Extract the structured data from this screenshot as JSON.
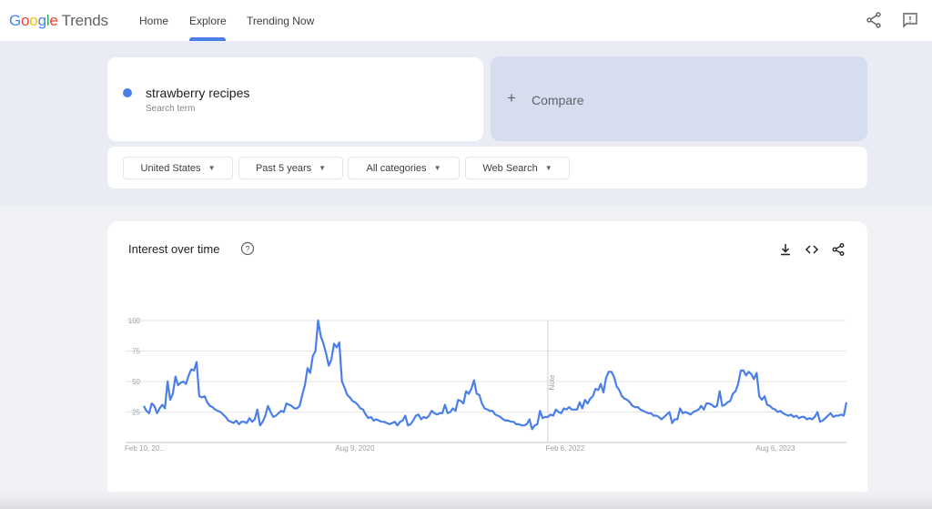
{
  "header": {
    "logo_letters": [
      "G",
      "o",
      "o",
      "g",
      "l",
      "e"
    ],
    "logo_product": "Trends",
    "nav": [
      {
        "label": "Home",
        "active": false
      },
      {
        "label": "Explore",
        "active": true
      },
      {
        "label": "Trending Now",
        "active": false
      }
    ],
    "icons": [
      "share-icon",
      "feedback-icon"
    ]
  },
  "search": {
    "term": "strawberry recipes",
    "term_type": "Search term",
    "term_color": "#4a7fe8",
    "compare_label": "Compare"
  },
  "filters": [
    {
      "label": "United States"
    },
    {
      "label": "Past 5 years"
    },
    {
      "label": "All categories"
    },
    {
      "label": "Web Search"
    }
  ],
  "interest_card": {
    "title": "Interest over time",
    "actions": [
      "download-icon",
      "embed-icon",
      "share-icon"
    ]
  },
  "chart_data": {
    "type": "line",
    "title": "Interest over time",
    "xlabel": "",
    "ylabel": "",
    "ylim": [
      0,
      100
    ],
    "yticks": [
      25,
      50,
      75,
      100
    ],
    "xtick_labels": [
      "Feb 10, 20...",
      "Aug 9, 2020",
      "Feb 6, 2022",
      "Aug 6, 2023"
    ],
    "xtick_positions": [
      0,
      0.3,
      0.6,
      0.9
    ],
    "annotation": {
      "label": "Note",
      "position": 0.575
    },
    "grid": true,
    "series": [
      {
        "name": "strawberry recipes",
        "color": "#4a7fe8",
        "values": [
          30,
          26,
          24,
          32,
          30,
          24,
          28,
          31,
          28,
          50,
          35,
          40,
          54,
          47,
          49,
          50,
          48,
          55,
          60,
          59,
          66,
          38,
          37,
          38,
          33,
          30,
          29,
          27,
          26,
          25,
          23,
          21,
          18,
          17,
          16,
          18,
          15,
          17,
          17,
          16,
          20,
          17,
          19,
          27,
          14,
          17,
          22,
          30,
          25,
          21,
          22,
          24,
          26,
          25,
          32,
          31,
          30,
          28,
          28,
          30,
          39,
          47,
          61,
          57,
          71,
          75,
          100,
          87,
          81,
          73,
          63,
          68,
          81,
          78,
          82,
          50,
          45,
          39,
          37,
          34,
          33,
          31,
          28,
          27,
          23,
          20,
          21,
          18,
          19,
          18,
          17,
          17,
          16,
          15,
          16,
          17,
          14,
          17,
          18,
          22,
          14,
          15,
          18,
          22,
          23,
          19,
          21,
          20,
          22,
          26,
          24,
          23,
          24,
          24,
          31,
          24,
          25,
          28,
          26,
          35,
          34,
          32,
          42,
          40,
          44,
          51,
          40,
          39,
          32,
          28,
          27,
          26,
          26,
          23,
          22,
          21,
          19,
          18,
          18,
          17,
          17,
          15,
          15,
          14,
          14,
          15,
          19,
          11,
          14,
          15,
          26,
          20,
          21,
          21,
          23,
          22,
          27,
          25,
          24,
          28,
          27,
          29,
          27,
          27,
          27,
          33,
          28,
          35,
          32,
          36,
          38,
          44,
          43,
          48,
          41,
          53,
          58,
          58,
          54,
          46,
          43,
          38,
          36,
          35,
          33,
          30,
          29,
          29,
          27,
          26,
          25,
          24,
          24,
          22,
          22,
          21,
          19,
          21,
          23,
          25,
          16,
          19,
          19,
          28,
          24,
          25,
          24,
          23,
          25,
          26,
          27,
          30,
          27,
          32,
          32,
          31,
          29,
          30,
          42,
          30,
          31,
          33,
          34,
          40,
          42,
          48,
          59,
          59,
          55,
          58,
          56,
          52,
          57,
          38,
          35,
          38,
          31,
          30,
          28,
          27,
          25,
          26,
          24,
          23,
          22,
          23,
          21,
          22,
          20,
          21,
          21,
          19,
          20,
          19,
          21,
          25,
          17,
          18,
          20,
          22,
          24,
          21,
          22,
          22,
          23,
          22,
          33
        ]
      }
    ]
  }
}
